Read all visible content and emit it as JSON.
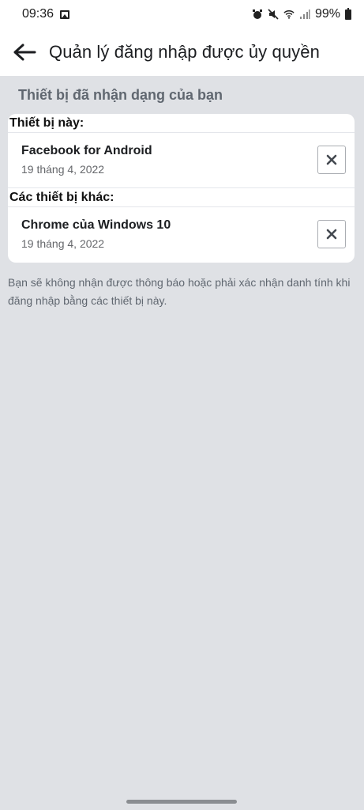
{
  "status_bar": {
    "time": "09:36",
    "battery": "99%",
    "icons": [
      "image-icon",
      "alarm-icon",
      "mute-icon",
      "wifi-icon",
      "signal-icon",
      "battery-icon"
    ]
  },
  "app_bar": {
    "title": "Quản lý đăng nhập được ủy quyền",
    "back_icon": "arrow-left-icon"
  },
  "section": {
    "title": "Thiết bị đã nhận dạng của bạn"
  },
  "devices": {
    "this_device_label": "Thiết bị này:",
    "this_device": {
      "name": "Facebook for Android",
      "date": "19 tháng 4, 2022"
    },
    "other_devices_label": "Các thiết bị khác:",
    "other_device": {
      "name": "Chrome của Windows 10",
      "date": "19 tháng 4, 2022"
    }
  },
  "note": "Bạn sẽ không nhận được thông báo hoặc phải xác nhận danh tính khi đăng nhập bằng các thiết bị này.",
  "colors": {
    "background": "#dfe1e5",
    "card": "#ffffff",
    "secondary_text": "#606770"
  }
}
